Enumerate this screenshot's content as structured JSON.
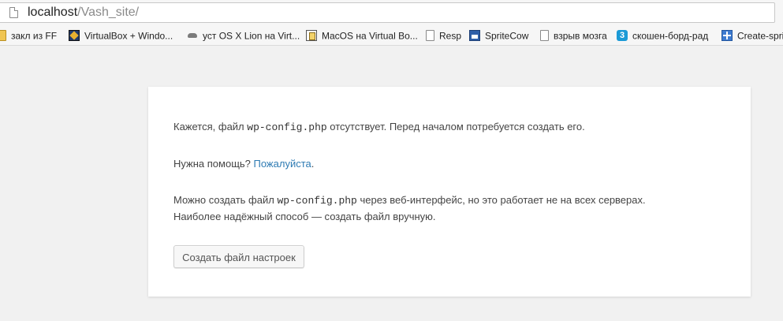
{
  "address_bar": {
    "host": "localhost",
    "path": "/Vash_site/"
  },
  "bookmarks": [
    {
      "label": "закл из FF",
      "icon": "folder-icon"
    },
    {
      "label": "VirtualBox + Windo...",
      "icon": "virtualbox-icon"
    },
    {
      "label": "уст OS X Lion на Virt...",
      "icon": "animal-icon"
    },
    {
      "label": "MacOS на Virtual Bo...",
      "icon": "macos-icon"
    },
    {
      "label": "Resp",
      "icon": "document-icon"
    },
    {
      "label": "SpriteCow",
      "icon": "spritecow-icon"
    },
    {
      "label": "взрыв мозга",
      "icon": "document-icon"
    },
    {
      "label": "скошен-борд-рад",
      "icon": "three-icon"
    },
    {
      "label": "Create-spri",
      "icon": "grid-icon"
    }
  ],
  "setup": {
    "p1_before": "Кажется, файл ",
    "p1_code": "wp-config.php",
    "p1_after": " отсутствует. Перед началом потребуется создать его.",
    "p2_before": "Нужна помощь? ",
    "p2_link": "Пожалуйста",
    "p2_after": ".",
    "p3_before": "Можно создать файл ",
    "p3_code": "wp-config.php",
    "p3_after": " через веб-интерфейс, но это работает не на всех серверах.",
    "p3_line2": "Наиболее надёжный способ — создать файл вручную.",
    "button_label": "Создать файл настроек"
  },
  "colors": {
    "page_background": "#f1f1f1",
    "card_background": "#ffffff",
    "link": "#2e7bb3",
    "text": "#444444"
  }
}
